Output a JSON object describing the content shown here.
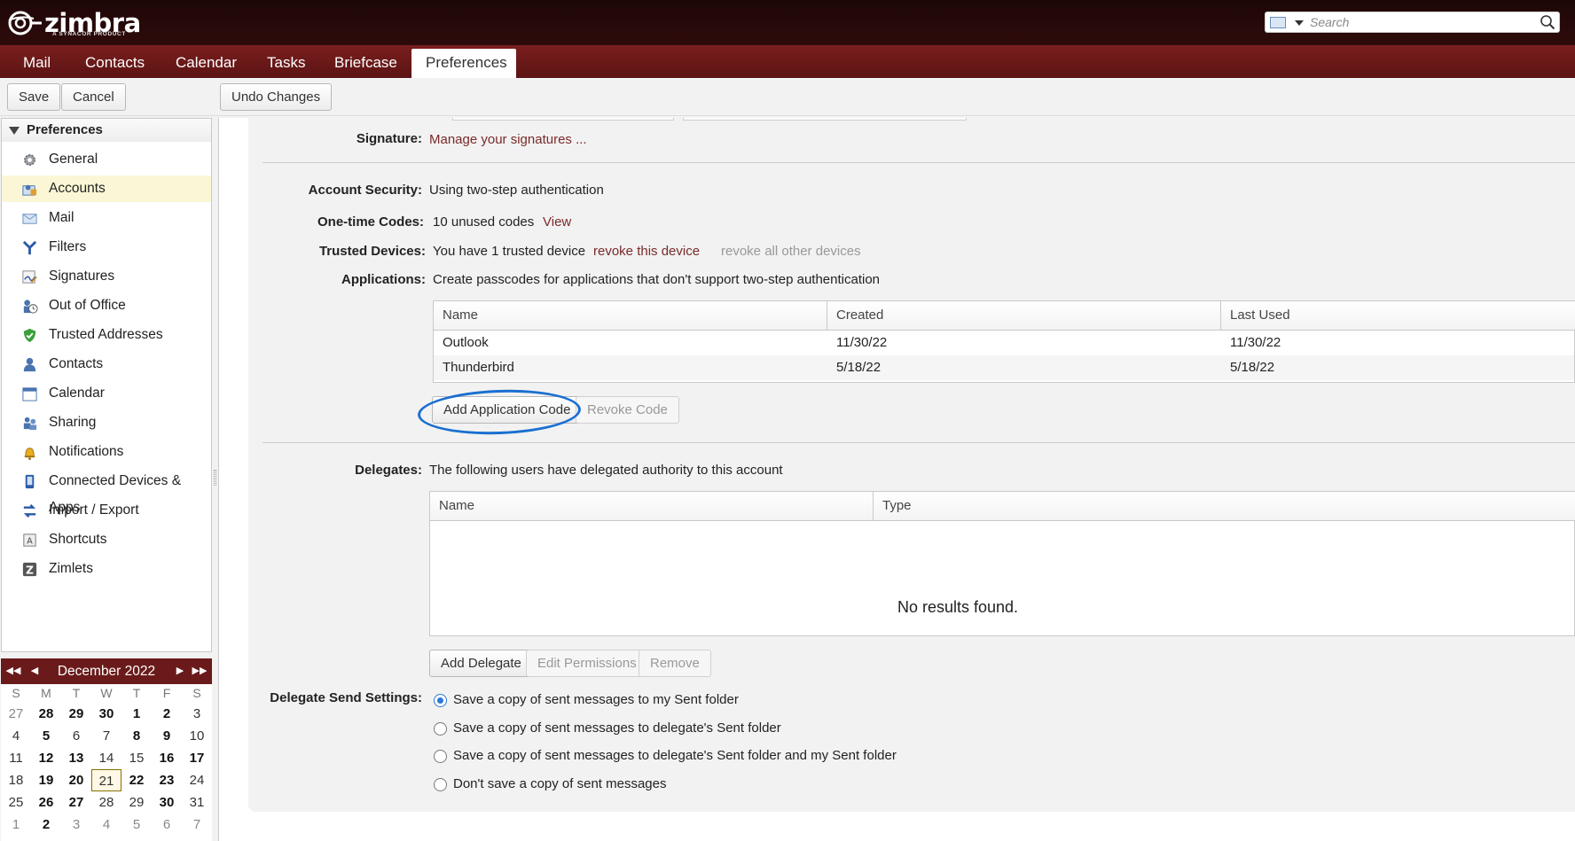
{
  "app": {
    "logo_text": "zimbra",
    "logo_sub": "A SYNACOR PRODUCT",
    "search_placeholder": "Search"
  },
  "tabs": [
    {
      "label": "Mail"
    },
    {
      "label": "Contacts"
    },
    {
      "label": "Calendar"
    },
    {
      "label": "Tasks"
    },
    {
      "label": "Briefcase"
    },
    {
      "label": "Preferences",
      "active": true
    }
  ],
  "toolbar": {
    "save": "Save",
    "cancel": "Cancel",
    "undo": "Undo Changes"
  },
  "sidebar": {
    "header": "Preferences",
    "items": [
      {
        "label": "General",
        "icon": "gear-icon"
      },
      {
        "label": "Accounts",
        "icon": "accounts-icon",
        "selected": true
      },
      {
        "label": "Mail",
        "icon": "envelope-icon"
      },
      {
        "label": "Filters",
        "icon": "filter-icon"
      },
      {
        "label": "Signatures",
        "icon": "signature-icon"
      },
      {
        "label": "Out of Office",
        "icon": "out-of-office-icon"
      },
      {
        "label": "Trusted Addresses",
        "icon": "shield-icon"
      },
      {
        "label": "Contacts",
        "icon": "contact-icon"
      },
      {
        "label": "Calendar",
        "icon": "calendar-icon"
      },
      {
        "label": "Sharing",
        "icon": "sharing-icon"
      },
      {
        "label": "Notifications",
        "icon": "bell-icon"
      },
      {
        "label": "Connected Devices & Apps",
        "icon": "device-icon"
      },
      {
        "label": "Import / Export",
        "icon": "import-export-icon"
      },
      {
        "label": "Shortcuts",
        "icon": "shortcut-icon"
      },
      {
        "label": "Zimlets",
        "icon": "zimlet-icon"
      }
    ]
  },
  "calendar": {
    "month_label": "December 2022",
    "dow": [
      "S",
      "M",
      "T",
      "W",
      "T",
      "F",
      "S"
    ],
    "weeks": [
      [
        {
          "d": "27",
          "o": 1
        },
        {
          "d": "28",
          "o": 1,
          "b": 1
        },
        {
          "d": "29",
          "o": 1,
          "b": 1
        },
        {
          "d": "30",
          "o": 1,
          "b": 1
        },
        {
          "d": "1",
          "b": 1
        },
        {
          "d": "2",
          "b": 1
        },
        {
          "d": "3"
        }
      ],
      [
        {
          "d": "4"
        },
        {
          "d": "5",
          "b": 1
        },
        {
          "d": "6"
        },
        {
          "d": "7"
        },
        {
          "d": "8",
          "b": 1
        },
        {
          "d": "9",
          "b": 1
        },
        {
          "d": "10"
        }
      ],
      [
        {
          "d": "11"
        },
        {
          "d": "12",
          "b": 1
        },
        {
          "d": "13",
          "b": 1
        },
        {
          "d": "14"
        },
        {
          "d": "15"
        },
        {
          "d": "16",
          "b": 1
        },
        {
          "d": "17",
          "b": 1
        }
      ],
      [
        {
          "d": "18"
        },
        {
          "d": "19",
          "b": 1
        },
        {
          "d": "20",
          "b": 1
        },
        {
          "d": "21",
          "t": 1
        },
        {
          "d": "22",
          "b": 1
        },
        {
          "d": "23",
          "b": 1
        },
        {
          "d": "24"
        }
      ],
      [
        {
          "d": "25"
        },
        {
          "d": "26",
          "b": 1
        },
        {
          "d": "27",
          "b": 1
        },
        {
          "d": "28"
        },
        {
          "d": "29"
        },
        {
          "d": "30",
          "b": 1
        },
        {
          "d": "31"
        }
      ],
      [
        {
          "d": "1",
          "o": 1
        },
        {
          "d": "2",
          "o": 1,
          "b": 1
        },
        {
          "d": "3",
          "o": 1
        },
        {
          "d": "4",
          "o": 1
        },
        {
          "d": "5",
          "o": 1
        },
        {
          "d": "6",
          "o": 1
        },
        {
          "d": "7",
          "o": 1
        }
      ]
    ]
  },
  "main": {
    "signature_label": "Signature:",
    "signature_link": "Manage your signatures ...",
    "account_security_label": "Account Security:",
    "account_security_value": "Using two-step authentication",
    "onetime_label": "One-time Codes:",
    "onetime_value": "10 unused codes",
    "onetime_view": "View",
    "trusted_label": "Trusted Devices:",
    "trusted_value": "You have 1 trusted device",
    "trusted_revoke": "revoke this device",
    "trusted_revoke_all": "revoke all other devices",
    "applications_label": "Applications:",
    "applications_value": "Create passcodes for applications that don't support two-step authentication",
    "app_table": {
      "columns": [
        "Name",
        "Created",
        "Last Used"
      ],
      "rows": [
        [
          "Outlook",
          "11/30/22",
          "11/30/22"
        ],
        [
          "Thunderbird",
          "5/18/22",
          "5/18/22"
        ]
      ]
    },
    "add_app_code": "Add Application Code",
    "revoke_code": "Revoke Code",
    "delegates_label": "Delegates:",
    "delegates_value": "The following users have delegated authority to this account",
    "delegate_table": {
      "columns": [
        "Name",
        "Type"
      ],
      "empty": "No results found."
    },
    "add_delegate": "Add Delegate",
    "edit_permissions": "Edit Permissions",
    "remove": "Remove",
    "delegate_send_label": "Delegate Send Settings:",
    "send_options": [
      {
        "label": "Save a copy of sent messages to my Sent folder",
        "checked": true
      },
      {
        "label": "Save a copy of sent messages to delegate's Sent folder",
        "checked": false
      },
      {
        "label": "Save a copy of sent messages to delegate's Sent folder and my Sent folder",
        "checked": false
      },
      {
        "label": "Don't save a copy of sent messages",
        "checked": false
      }
    ]
  },
  "colors": {
    "accent_dark": "#2e0b0b",
    "tab_bar": "#6a1a1a",
    "link": "#7a2a2a",
    "annotation": "#1a6fd1",
    "selected_row": "#fbf7d6"
  }
}
